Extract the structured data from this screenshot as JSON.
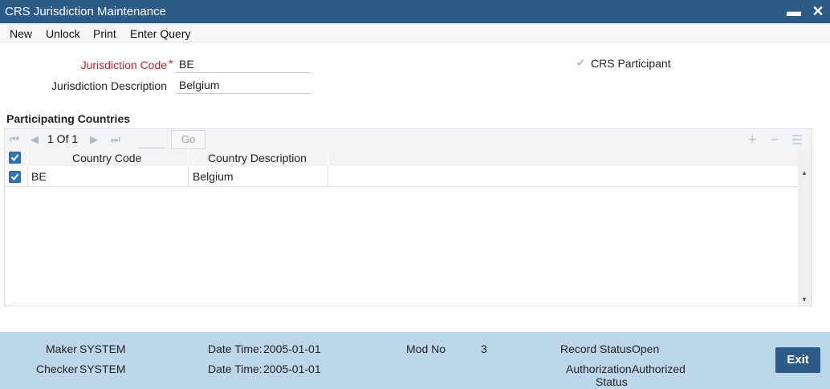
{
  "window": {
    "title": "CRS Jurisdiction Maintenance",
    "minimize_glyph": "▬",
    "close_glyph": "✕"
  },
  "menu": {
    "new": "New",
    "unlock": "Unlock",
    "print": "Print",
    "enter_query": "Enter Query"
  },
  "form": {
    "jurisdiction_code_label": "Jurisdiction Code",
    "required_mark": "*",
    "jurisdiction_code_value": "BE",
    "jurisdiction_description_label": "Jurisdiction Description",
    "jurisdiction_description_value": "Belgium",
    "crs_participant_label": "CRS Participant",
    "crs_participant_checked": true
  },
  "participating_countries": {
    "section_title": "Participating Countries",
    "pager": {
      "page_text": "1 Of 1",
      "go_label": "Go"
    },
    "columns": [
      "Country Code",
      "Country Description"
    ],
    "rows": [
      {
        "code": "BE",
        "description": "Belgium",
        "checked": true
      }
    ]
  },
  "footer": {
    "maker_label": "Maker",
    "maker_value": "SYSTEM",
    "checker_label": "Checker",
    "checker_value": "SYSTEM",
    "date_time_label": "Date Time:",
    "maker_date": "2005-01-01",
    "checker_date": "2005-01-01",
    "mod_no_label": "Mod No",
    "mod_no_value": "3",
    "record_status_label": "Record Status",
    "record_status_value": "Open",
    "authorization_label_line1": "Authorization",
    "authorization_label_line2": "Status",
    "authorization_value": "Authorized",
    "exit_label": "Exit"
  },
  "colors": {
    "title_bar": "#2b5b86",
    "footer": "#bcd6ea",
    "required": "#d0202a",
    "checkbox": "#2f74b5"
  }
}
